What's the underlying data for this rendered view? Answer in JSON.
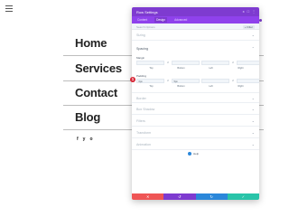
{
  "page": {
    "menu": [
      "Home",
      "Services",
      "Contact",
      "Blog"
    ],
    "socials": [
      "f",
      "y",
      "o"
    ]
  },
  "modal": {
    "title": "Row Settings",
    "header_icons": [
      "x",
      "□",
      "⋮"
    ],
    "tabs": [
      "Content",
      "Design",
      "Advanced"
    ],
    "active_tab": "Design",
    "search_placeholder": "Search Options",
    "filter_label": "+ Filter",
    "sections": {
      "sizing": "Sizing",
      "spacing": "Spacing",
      "border": "Border",
      "box_shadow": "Box Shadow",
      "filters": "Filters",
      "transform": "Transform",
      "animation": "Animation"
    },
    "margin": {
      "label": "Margin",
      "values": [
        "",
        "",
        "",
        ""
      ],
      "captions": [
        "Top",
        "Bottom",
        "Left",
        "Right"
      ]
    },
    "padding": {
      "label": "Padding",
      "values": [
        "0px",
        "5px",
        "",
        ""
      ],
      "captions": [
        "Top",
        "Bottom",
        "Left",
        "Right"
      ]
    },
    "help": "Help",
    "footer": [
      {
        "icon": "✕",
        "color": "#ef5555"
      },
      {
        "icon": "↺",
        "color": "#7e3bd0"
      },
      {
        "icon": "↻",
        "color": "#2b87da"
      },
      {
        "icon": "✓",
        "color": "#29c4a9"
      }
    ],
    "marker": "1"
  }
}
